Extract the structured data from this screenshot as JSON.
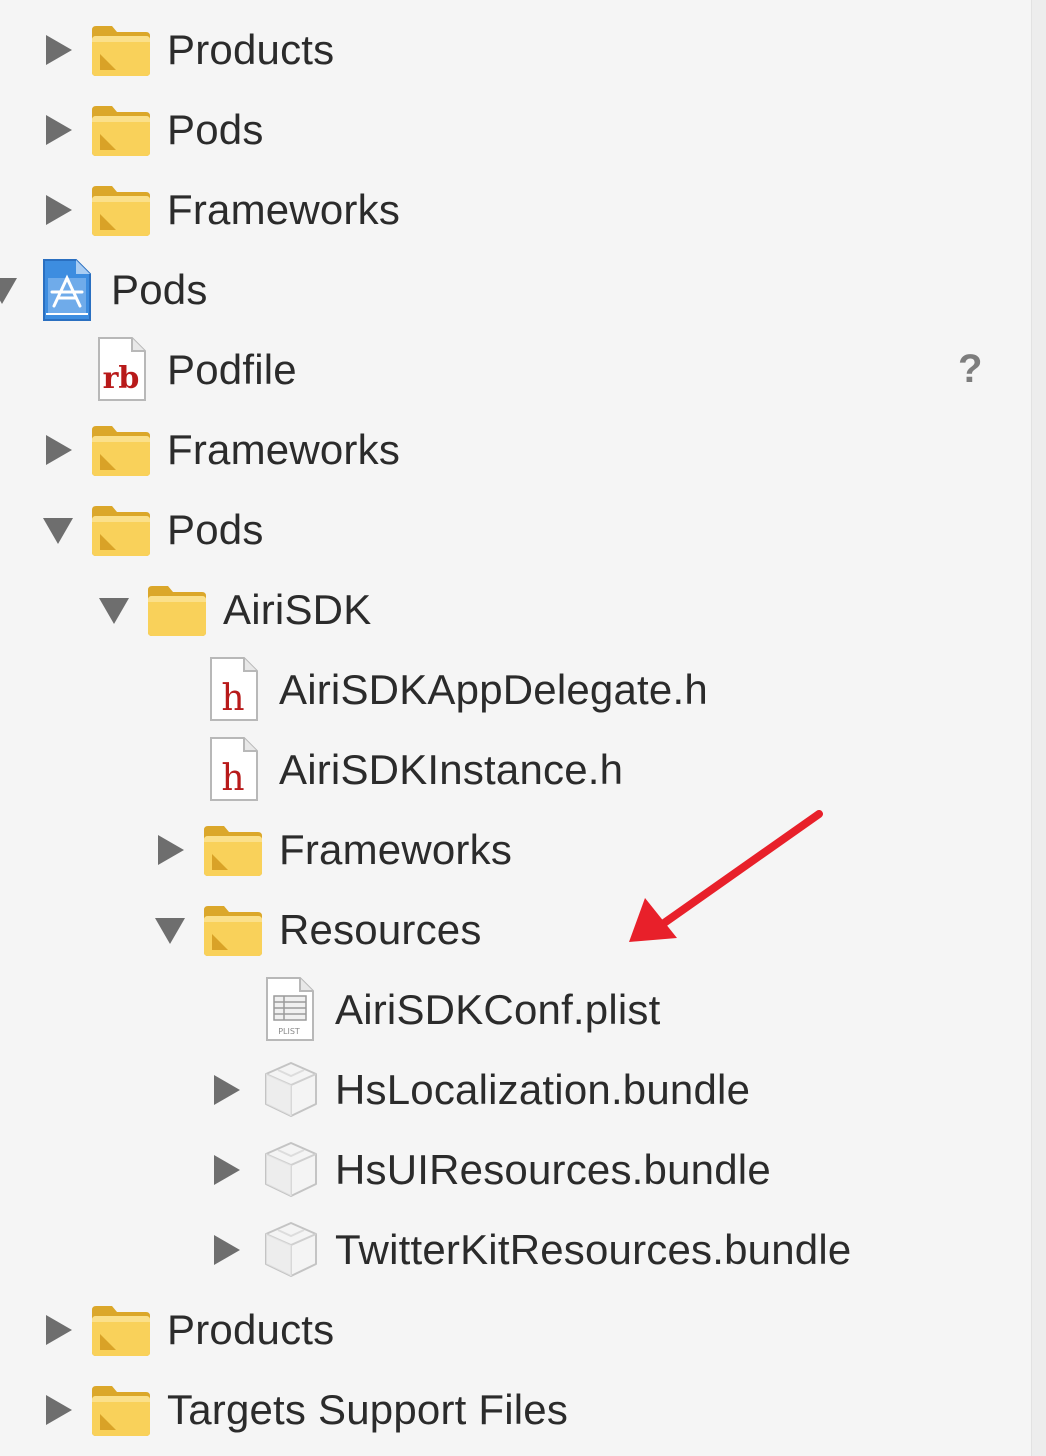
{
  "navigator": {
    "rows": [
      {
        "label": "Products",
        "icon": "folder-icon",
        "disclosure": "collapsed"
      },
      {
        "label": "Pods",
        "icon": "folder-icon",
        "disclosure": "collapsed"
      },
      {
        "label": "Frameworks",
        "icon": "folder-icon",
        "disclosure": "collapsed"
      },
      {
        "label": "Pods",
        "icon": "xcode-project-icon",
        "disclosure": "expanded"
      },
      {
        "label": "Podfile",
        "icon": "ruby-file-icon",
        "disclosure": "none",
        "status": "?"
      },
      {
        "label": "Frameworks",
        "icon": "folder-icon",
        "disclosure": "collapsed"
      },
      {
        "label": "Pods",
        "icon": "folder-icon",
        "disclosure": "expanded"
      },
      {
        "label": "AiriSDK",
        "icon": "folder-icon",
        "disclosure": "expanded"
      },
      {
        "label": "AiriSDKAppDelegate.h",
        "icon": "header-file-icon",
        "disclosure": "none"
      },
      {
        "label": "AiriSDKInstance.h",
        "icon": "header-file-icon",
        "disclosure": "none"
      },
      {
        "label": "Frameworks",
        "icon": "folder-icon",
        "disclosure": "collapsed"
      },
      {
        "label": "Resources",
        "icon": "folder-icon",
        "disclosure": "expanded"
      },
      {
        "label": "AiriSDKConf.plist",
        "icon": "plist-file-icon",
        "disclosure": "none"
      },
      {
        "label": "HsLocalization.bundle",
        "icon": "bundle-icon",
        "disclosure": "collapsed"
      },
      {
        "label": "HsUIResources.bundle",
        "icon": "bundle-icon",
        "disclosure": "collapsed"
      },
      {
        "label": "TwitterKitResources.bundle",
        "icon": "bundle-icon",
        "disclosure": "collapsed"
      },
      {
        "label": "Products",
        "icon": "folder-icon",
        "disclosure": "collapsed"
      },
      {
        "label": "Targets Support Files",
        "icon": "folder-icon",
        "disclosure": "collapsed"
      }
    ],
    "icon_text": {
      "ruby": "rb",
      "header": "h",
      "plist": "PLIST"
    }
  },
  "colors": {
    "background": "#f5f5f5",
    "text": "#2b2b2b",
    "disclosure": "#6e6e6e",
    "folder_body": "#f8cf52",
    "folder_edge": "#d9a628",
    "annotation_arrow": "#e8202a"
  }
}
